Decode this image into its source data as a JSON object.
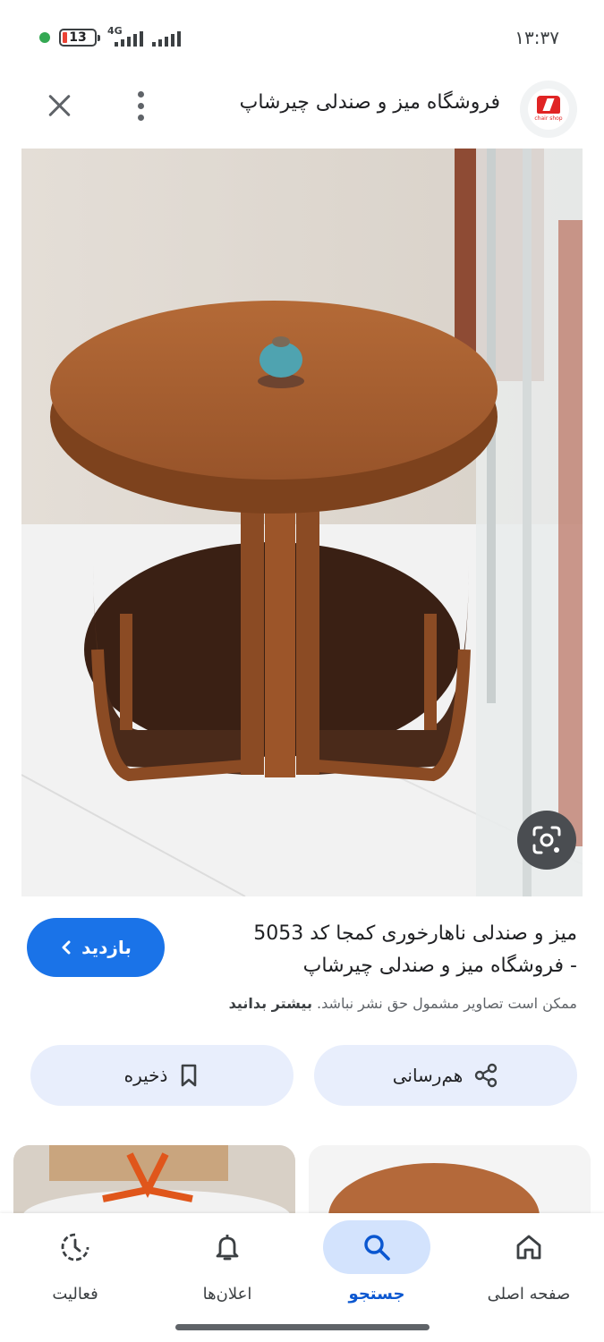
{
  "status_bar": {
    "time": "۱۳:۳۷",
    "battery": "13",
    "network": "4G"
  },
  "header": {
    "title": "فروشگاه میز و صندلی چیرشاپ",
    "logo_text": "chair shop"
  },
  "result": {
    "title_line1": "میز و صندلی ناهارخوری کمجا کد 5053",
    "title_line2": "- فروشگاه میز و صندلی چیرشاپ",
    "copyright_text": "ممکن است تصاویر مشمول حق نشر نباشد.",
    "learn_more": "بیشتر بدانید",
    "visit_label": "بازدید"
  },
  "actions": {
    "share_label": "هم‌رسانی",
    "save_label": "ذخیره"
  },
  "bottom_nav": {
    "home": "صفحه اصلی",
    "search": "جستجو",
    "notifications": "اعلان‌ها",
    "activity": "فعالیت"
  },
  "colors": {
    "accent": "#1a73e8",
    "pill_bg": "#e8eefc",
    "active_nav_bg": "#d3e3fd",
    "battery_low": "#ea4335",
    "status_dot": "#34a853"
  }
}
